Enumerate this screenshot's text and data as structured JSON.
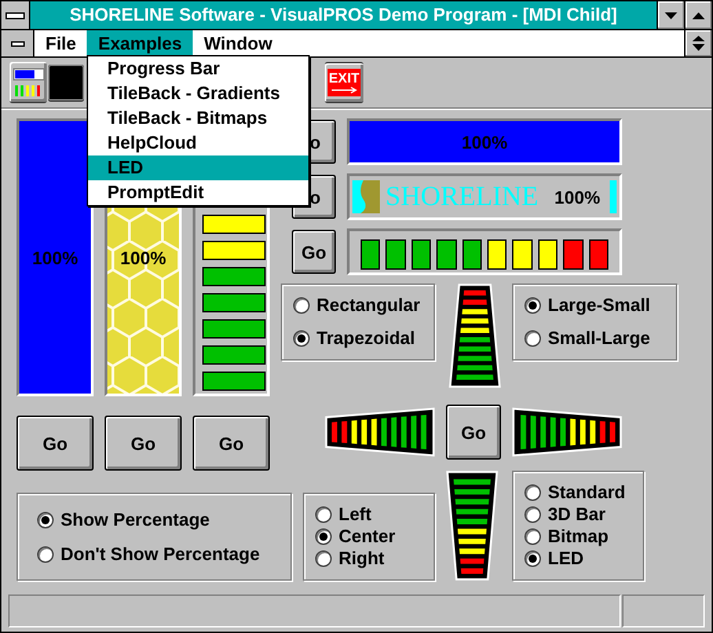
{
  "window": {
    "title": "SHORELINE Software - VisualPROS Demo Program - [MDI Child]"
  },
  "menu_bar": [
    {
      "label": "File",
      "selected": false
    },
    {
      "label": "Examples",
      "selected": true
    },
    {
      "label": "Window",
      "selected": false
    }
  ],
  "menu": [
    {
      "label": "Progress Bar",
      "selected": false
    },
    {
      "label": "TileBack - Gradients",
      "selected": false
    },
    {
      "label": "TileBack - Bitmaps",
      "selected": false
    },
    {
      "label": "HelpCloud",
      "selected": false
    },
    {
      "label": "LED",
      "selected": true
    },
    {
      "label": "PromptEdit",
      "selected": false
    }
  ],
  "toolbar": [
    {
      "kind": "meter"
    },
    {
      "kind": "swatch"
    },
    {
      "kind": "exit",
      "label": "EXIT"
    }
  ],
  "vertical_bars": [
    {
      "kind": "solid",
      "level": 1,
      "reading": "100%"
    },
    {
      "kind": "honeycomb",
      "level": 1,
      "reading": "100%"
    },
    {
      "kind": "led"
    }
  ],
  "vertical_buttons": [
    "Go",
    "Go",
    "Go"
  ],
  "horizontal_bars": [
    {
      "button": "o",
      "kind": "solid",
      "level": 1,
      "reading": "100%"
    },
    {
      "button": "o",
      "kind": "bitmap",
      "banner": "SHORELINE",
      "level": 1,
      "reading": "100%"
    },
    {
      "button": "Go",
      "kind": "led"
    }
  ],
  "shape_options": [
    {
      "label": "Rectangular",
      "selected": false
    },
    {
      "label": "Trapezoidal",
      "selected": true
    }
  ],
  "direction_options": [
    {
      "label": "Large-Small",
      "selected": true
    },
    {
      "label": "Small-Large",
      "selected": false
    }
  ],
  "center_button": "Go",
  "percentage_options": [
    {
      "label": "Show Percentage",
      "selected": true
    },
    {
      "label": "Don't Show Percentage",
      "selected": false
    }
  ],
  "align_options": [
    {
      "label": "Left",
      "selected": false
    },
    {
      "label": "Center",
      "selected": true
    },
    {
      "label": "Right",
      "selected": false
    }
  ],
  "style_options": [
    {
      "label": "Standard",
      "selected": false
    },
    {
      "label": "3D Bar",
      "selected": false
    },
    {
      "label": "Bitmap",
      "selected": false
    },
    {
      "label": "LED",
      "selected": true
    }
  ]
}
